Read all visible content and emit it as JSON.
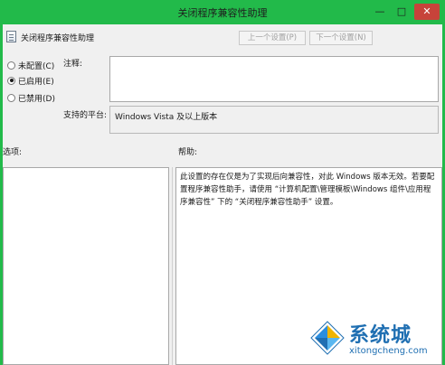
{
  "window": {
    "title": "关闭程序兼容性助理",
    "controls": {
      "minimize": "—",
      "maximize": "□",
      "close": "✕"
    },
    "accent_color": "#22ba4a"
  },
  "header": {
    "policy_name": "关闭程序兼容性助理",
    "prev_setting": "上一个设置(P)",
    "next_setting": "下一个设置(N)"
  },
  "options": [
    {
      "label": "未配置(C)",
      "checked": false
    },
    {
      "label": "已启用(E)",
      "checked": true
    },
    {
      "label": "已禁用(D)",
      "checked": false
    }
  ],
  "comment": {
    "label": "注释:",
    "value": ""
  },
  "supported": {
    "label": "支持的平台:",
    "value": "Windows Vista 及以上版本"
  },
  "options_pane": {
    "label": "选项:"
  },
  "help_pane": {
    "label": "帮助:",
    "text": "此设置的存在仅是为了实现后向兼容性，对此 Windows 版本无效。若要配置程序兼容性助手，请使用 “计算机配置\\管理模板\\Windows 组件\\应用程序兼容性” 下的 “关闭程序兼容性助手” 设置。"
  },
  "watermark": {
    "brand": "系统城",
    "url": "xitongcheng.com"
  }
}
